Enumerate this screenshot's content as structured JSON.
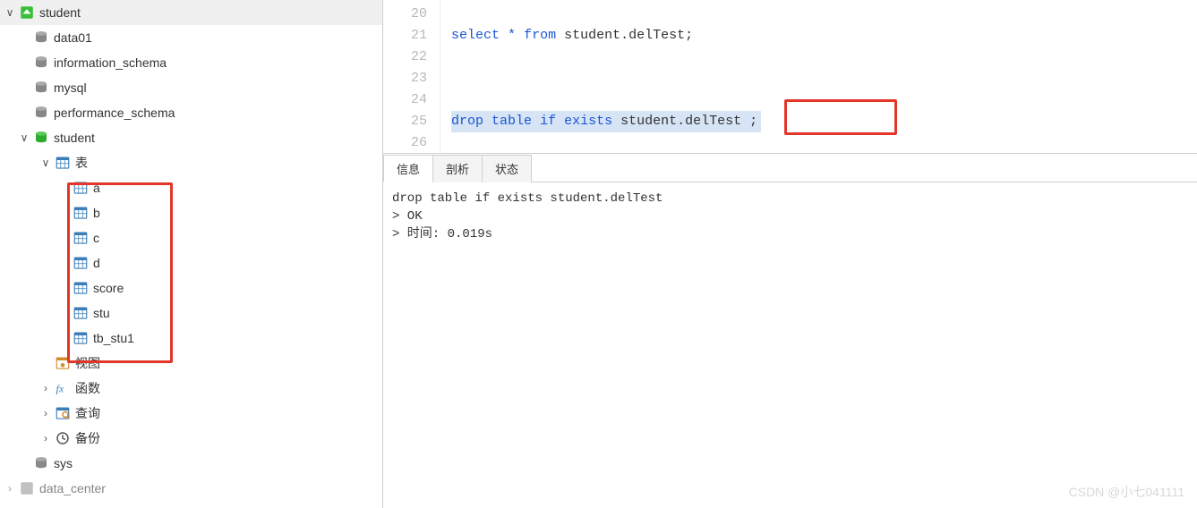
{
  "tree": {
    "conn": "student",
    "dbs": [
      "data01",
      "information_schema",
      "mysql",
      "performance_schema"
    ],
    "student_db": "student",
    "tables_label": "表",
    "tables": [
      "a",
      "b",
      "c",
      "d",
      "score",
      "stu",
      "tb_stu1"
    ],
    "views_label": "视图",
    "functions_label": "函数",
    "queries_label": "查询",
    "backups_label": "备份",
    "sys_db": "sys",
    "bottom": "data_center"
  },
  "editor": {
    "lines": [
      "20",
      "21",
      "22",
      "23",
      "24",
      "25",
      "26"
    ],
    "l21": {
      "select": "select",
      "star": "*",
      "from": "from",
      "tbl": "student.delTest;"
    },
    "l25": {
      "drop": "drop",
      "table": "table",
      "if": "if",
      "exists": "exists",
      "tbl": "student.",
      "tbl2": "delTest ;"
    }
  },
  "tabs": {
    "info": "信息",
    "profile": "剖析",
    "status": "状态"
  },
  "output": {
    "l1": "drop table if exists student.delTest",
    "l2": "> OK",
    "l3": "> 时间: 0.019s"
  },
  "watermark": "CSDN @小七041111"
}
